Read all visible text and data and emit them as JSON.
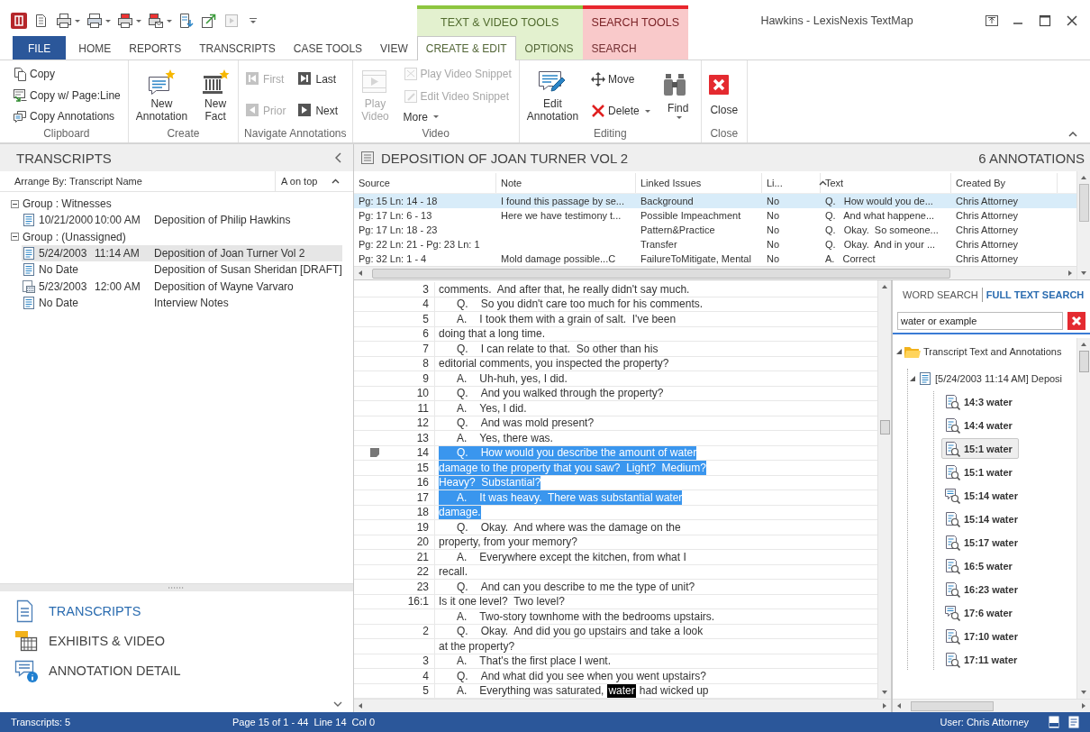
{
  "window": {
    "title": "Hawkins - LexisNexis TextMap"
  },
  "tabs": [
    {
      "label": "FILE",
      "kind": "file",
      "selected": false
    },
    {
      "label": "HOME",
      "kind": "tab",
      "selected": false
    },
    {
      "label": "REPORTS",
      "kind": "tab",
      "selected": false
    },
    {
      "label": "TRANSCRIPTS",
      "kind": "tab",
      "selected": false
    },
    {
      "label": "CASE TOOLS",
      "kind": "tab",
      "selected": false
    },
    {
      "label": "VIEW",
      "kind": "tab",
      "selected": false
    }
  ],
  "context_groups": [
    {
      "label": "TEXT & VIDEO TOOLS",
      "color": "#8dc63f",
      "tabs": [
        {
          "label": "CREATE & EDIT",
          "kind": "tab",
          "selected": true
        },
        {
          "label": "OPTIONS",
          "kind": "tab",
          "selected": false
        }
      ]
    },
    {
      "label": "SEARCH TOOLS",
      "color": "#e8252c",
      "tabs": [
        {
          "label": "SEARCH",
          "kind": "tab",
          "selected": false
        }
      ]
    }
  ],
  "ribbon": {
    "groups": [
      {
        "label": "Clipboard",
        "columns": [
          [
            {
              "label": "Copy",
              "kind": "small",
              "disabled": false,
              "dropdown": false
            },
            {
              "label": "Copy w/ Page:Line",
              "kind": "small",
              "disabled": false,
              "dropdown": false
            },
            {
              "label": "Copy Annotations",
              "kind": "small",
              "disabled": false,
              "dropdown": false
            }
          ]
        ]
      },
      {
        "label": "Create",
        "columns": [
          [
            {
              "label": "New Annotation",
              "kind": "large",
              "disabled": false,
              "dropdown": false
            }
          ],
          [
            {
              "label": "New Fact",
              "kind": "large",
              "disabled": false,
              "dropdown": false
            }
          ]
        ]
      },
      {
        "label": "Navigate Annotations",
        "columns": [
          [
            {
              "label": "First",
              "kind": "small",
              "disabled": true,
              "dropdown": false
            },
            {
              "label": "Prior",
              "kind": "small",
              "disabled": true,
              "dropdown": false
            }
          ],
          [
            {
              "label": "Last",
              "kind": "small",
              "disabled": false,
              "dropdown": false
            },
            {
              "label": "Next",
              "kind": "small",
              "disabled": false,
              "dropdown": false
            }
          ]
        ]
      },
      {
        "label": "Video",
        "columns": [
          [
            {
              "label": "Play Video",
              "kind": "large",
              "disabled": true,
              "dropdown": false
            }
          ],
          [
            {
              "label": "Play Video Snippet",
              "kind": "small",
              "disabled": true,
              "dropdown": false
            },
            {
              "label": "Edit Video Snippet",
              "kind": "small",
              "disabled": true,
              "dropdown": false
            },
            {
              "label": "More",
              "kind": "small",
              "disabled": false,
              "dropdown": true
            }
          ]
        ]
      },
      {
        "label": "Editing",
        "columns": [
          [
            {
              "label": "Edit Annotation",
              "kind": "large",
              "disabled": false,
              "dropdown": false
            }
          ],
          [
            {
              "label": "Move",
              "kind": "small",
              "disabled": false,
              "dropdown": false
            },
            {
              "label": "Delete",
              "kind": "small",
              "disabled": false,
              "dropdown": true
            }
          ],
          [
            {
              "label": "Find",
              "kind": "large",
              "disabled": false,
              "dropdown": true
            }
          ]
        ]
      },
      {
        "label": "Close",
        "columns": [
          [
            {
              "label": "Close",
              "kind": "large",
              "disabled": false,
              "dropdown": false
            }
          ]
        ]
      }
    ]
  },
  "transcripts_panel": {
    "title": "TRANSCRIPTS",
    "arrange_label": "Arrange By: Transcript Name",
    "sort_label": "A on top",
    "groups": [
      {
        "label": "Group : Witnesses",
        "expanded": true,
        "children": [
          {
            "date": "10/21/2000",
            "time": "10:00 AM",
            "name": "Deposition of Philip Hawkins",
            "kind": "text",
            "selected": false
          }
        ]
      },
      {
        "label": "Group : (Unassigned)",
        "expanded": true,
        "children": [
          {
            "date": "5/24/2003",
            "time": "11:14 AM",
            "name": "Deposition of Joan Turner Vol 2",
            "kind": "text",
            "selected": true
          },
          {
            "date": "No Date",
            "name": "Deposition of Susan Sheridan [DRAFT]",
            "kind": "text",
            "selected": false
          },
          {
            "date": "5/23/2003",
            "time": "12:00 AM",
            "name": "Deposition of Wayne Varvaro",
            "kind": "video",
            "selected": false
          },
          {
            "date": "No Date",
            "name": "Interview Notes",
            "kind": "text",
            "selected": false
          }
        ]
      }
    ],
    "navigation": [
      {
        "label": "TRANSCRIPTS",
        "selected": true
      },
      {
        "label": "EXHIBITS & VIDEO",
        "selected": false
      },
      {
        "label": "ANNOTATION DETAIL",
        "selected": false
      }
    ]
  },
  "annotations": {
    "title": "DEPOSITION OF JOAN TURNER VOL 2",
    "count": "6 ANNOTATIONS",
    "columns": [
      "Source",
      "Note",
      "Linked Issues",
      "Li...",
      "Text",
      "Created By"
    ],
    "rows": [
      {
        "cells": [
          "Pg: 15 Ln: 14 - 18",
          "I found this passage by se...",
          "Background",
          "No",
          "Q.   How would you de...",
          "Chris Attorney"
        ],
        "selected": true
      },
      {
        "cells": [
          "Pg: 17 Ln: 6 - 13",
          "Here we have testimony t...",
          "Possible Impeachment",
          "No",
          "Q.   And what happene...",
          "Chris Attorney"
        ],
        "selected": false
      },
      {
        "cells": [
          "Pg: 17 Ln: 18 - 23",
          "",
          "Pattern&Practice",
          "No",
          "Q.   Okay.  So someone...",
          "Chris Attorney"
        ],
        "selected": false
      },
      {
        "cells": [
          "Pg: 22 Ln: 21 - Pg: 23 Ln: 1",
          "",
          "Transfer",
          "No",
          "Q.   Okay.  And in your ...",
          "Chris Attorney"
        ],
        "selected": false
      },
      {
        "cells": [
          "Pg: 32 Ln: 1 - 4",
          "Mold damage possible...C",
          "FailureToMitigate, Mental",
          "No",
          "A.   Correct",
          "Chris Attorney"
        ],
        "selected": false
      }
    ]
  },
  "transcript": {
    "lines": [
      {
        "number": "3",
        "text": "comments.  And after that, he really didn't say much.",
        "highlighted": false,
        "annotated": false
      },
      {
        "number": "4",
        "speaker": "Q.",
        "text": "So you didn't care too much for his comments.",
        "highlighted": false,
        "annotated": false
      },
      {
        "number": "5",
        "speaker": "A.",
        "text": "I took them with a grain of salt.  I've been",
        "highlighted": false,
        "annotated": false
      },
      {
        "number": "6",
        "text": "doing that a long time.",
        "highlighted": false,
        "annotated": false
      },
      {
        "number": "7",
        "speaker": "Q.",
        "text": "I can relate to that.  So other than his",
        "highlighted": false,
        "annotated": false
      },
      {
        "number": "8",
        "text": "editorial comments, you inspected the property?",
        "highlighted": false,
        "annotated": false
      },
      {
        "number": "9",
        "speaker": "A.",
        "text": "Uh-huh, yes, I did.",
        "highlighted": false,
        "annotated": false
      },
      {
        "number": "10",
        "speaker": "Q.",
        "text": "And you walked through the property?",
        "highlighted": false,
        "annotated": false
      },
      {
        "number": "11",
        "speaker": "A.",
        "text": "Yes, I did.",
        "highlighted": false,
        "annotated": false
      },
      {
        "number": "12",
        "speaker": "Q.",
        "text": "And was mold present?",
        "highlighted": false,
        "annotated": false
      },
      {
        "number": "13",
        "speaker": "A.",
        "text": "Yes, there was.",
        "highlighted": false,
        "annotated": false
      },
      {
        "number": "14",
        "speaker": "Q.",
        "text": "How would you describe the amount of water",
        "highlighted": true,
        "annotated": true
      },
      {
        "number": "15",
        "text": "damage to the property that you saw?  Light?  Medium?",
        "highlighted": true,
        "annotated": false
      },
      {
        "number": "16",
        "text": "Heavy?  Substantial?",
        "highlighted": true,
        "annotated": false
      },
      {
        "number": "17",
        "speaker": "A.",
        "text": "It was heavy.  There was substantial water",
        "highlighted": true,
        "annotated": false
      },
      {
        "number": "18",
        "text": "damage.",
        "highlighted": true,
        "annotated": false
      },
      {
        "number": "19",
        "speaker": "Q.",
        "text": "Okay.  And where was the damage on the",
        "highlighted": false,
        "annotated": false
      },
      {
        "number": "20",
        "text": "property, from your memory?",
        "highlighted": false,
        "annotated": false
      },
      {
        "number": "21",
        "speaker": "A.",
        "text": "Everywhere except the kitchen, from what I",
        "highlighted": false,
        "annotated": false
      },
      {
        "number": "22",
        "text": "recall.",
        "highlighted": false,
        "annotated": false
      },
      {
        "number": "23",
        "speaker": "Q.",
        "text": "And can you describe to me the type of unit?",
        "highlighted": false,
        "annotated": false
      },
      {
        "number": "16:1",
        "text": "Is it one level?  Two level?",
        "highlighted": false,
        "annotated": false
      },
      {
        "speaker": "A.",
        "text": "Two-story townhome with the bedrooms upstairs.",
        "highlighted": false,
        "annotated": false
      },
      {
        "number": "2",
        "speaker": "Q.",
        "text": "Okay.  And did you go upstairs and take a look",
        "highlighted": false,
        "annotated": false
      },
      {
        "text": "at the property?",
        "highlighted": false,
        "annotated": false
      },
      {
        "number": "3",
        "speaker": "A.",
        "text": "That's the first place I went.",
        "highlighted": false,
        "annotated": false
      },
      {
        "number": "4",
        "speaker": "Q.",
        "text": "And what did you see when you went upstairs?",
        "highlighted": false,
        "annotated": false
      },
      {
        "number": "5",
        "speaker": "A.",
        "text": "Everything was saturated,",
        "match": "water",
        "after": "had wicked up",
        "highlighted": false,
        "annotated": false
      }
    ]
  },
  "search_panel": {
    "tabs": [
      {
        "label": "WORD SEARCH",
        "selected": false
      },
      {
        "label": "FULL TEXT SEARCH",
        "selected": true
      }
    ],
    "query": "water or example",
    "results": {
      "label": "Transcript Text and Annotations",
      "expanded": true,
      "children": [
        {
          "label": "[5/24/2003 11:14 AM] Deposi",
          "expanded": true,
          "children": [
            {
              "label": "14:3 water",
              "kind": "text",
              "selected": false
            },
            {
              "label": "14:4 water",
              "kind": "text",
              "selected": false
            },
            {
              "label": "15:1 water",
              "kind": "text",
              "selected": true
            },
            {
              "label": "15:1 water",
              "kind": "text",
              "selected": false
            },
            {
              "label": "15:14 water",
              "kind": "note",
              "selected": false
            },
            {
              "label": "15:14 water",
              "kind": "text",
              "selected": false
            },
            {
              "label": "15:17 water",
              "kind": "text",
              "selected": false
            },
            {
              "label": "16:5 water",
              "kind": "text",
              "selected": false
            },
            {
              "label": "16:23 water",
              "kind": "text",
              "selected": false
            },
            {
              "label": "17:6 water",
              "kind": "note",
              "selected": false
            },
            {
              "label": "17:10 water",
              "kind": "text",
              "selected": false
            },
            {
              "label": "17:11 water",
              "kind": "text",
              "selected": false
            }
          ]
        }
      ]
    }
  },
  "status_bar": {
    "transcripts": "Transcripts: 5",
    "page": "Page 15 of 1 - 44",
    "line": "Line 14",
    "column": "Col 0",
    "user": "User: Chris Attorney"
  }
}
